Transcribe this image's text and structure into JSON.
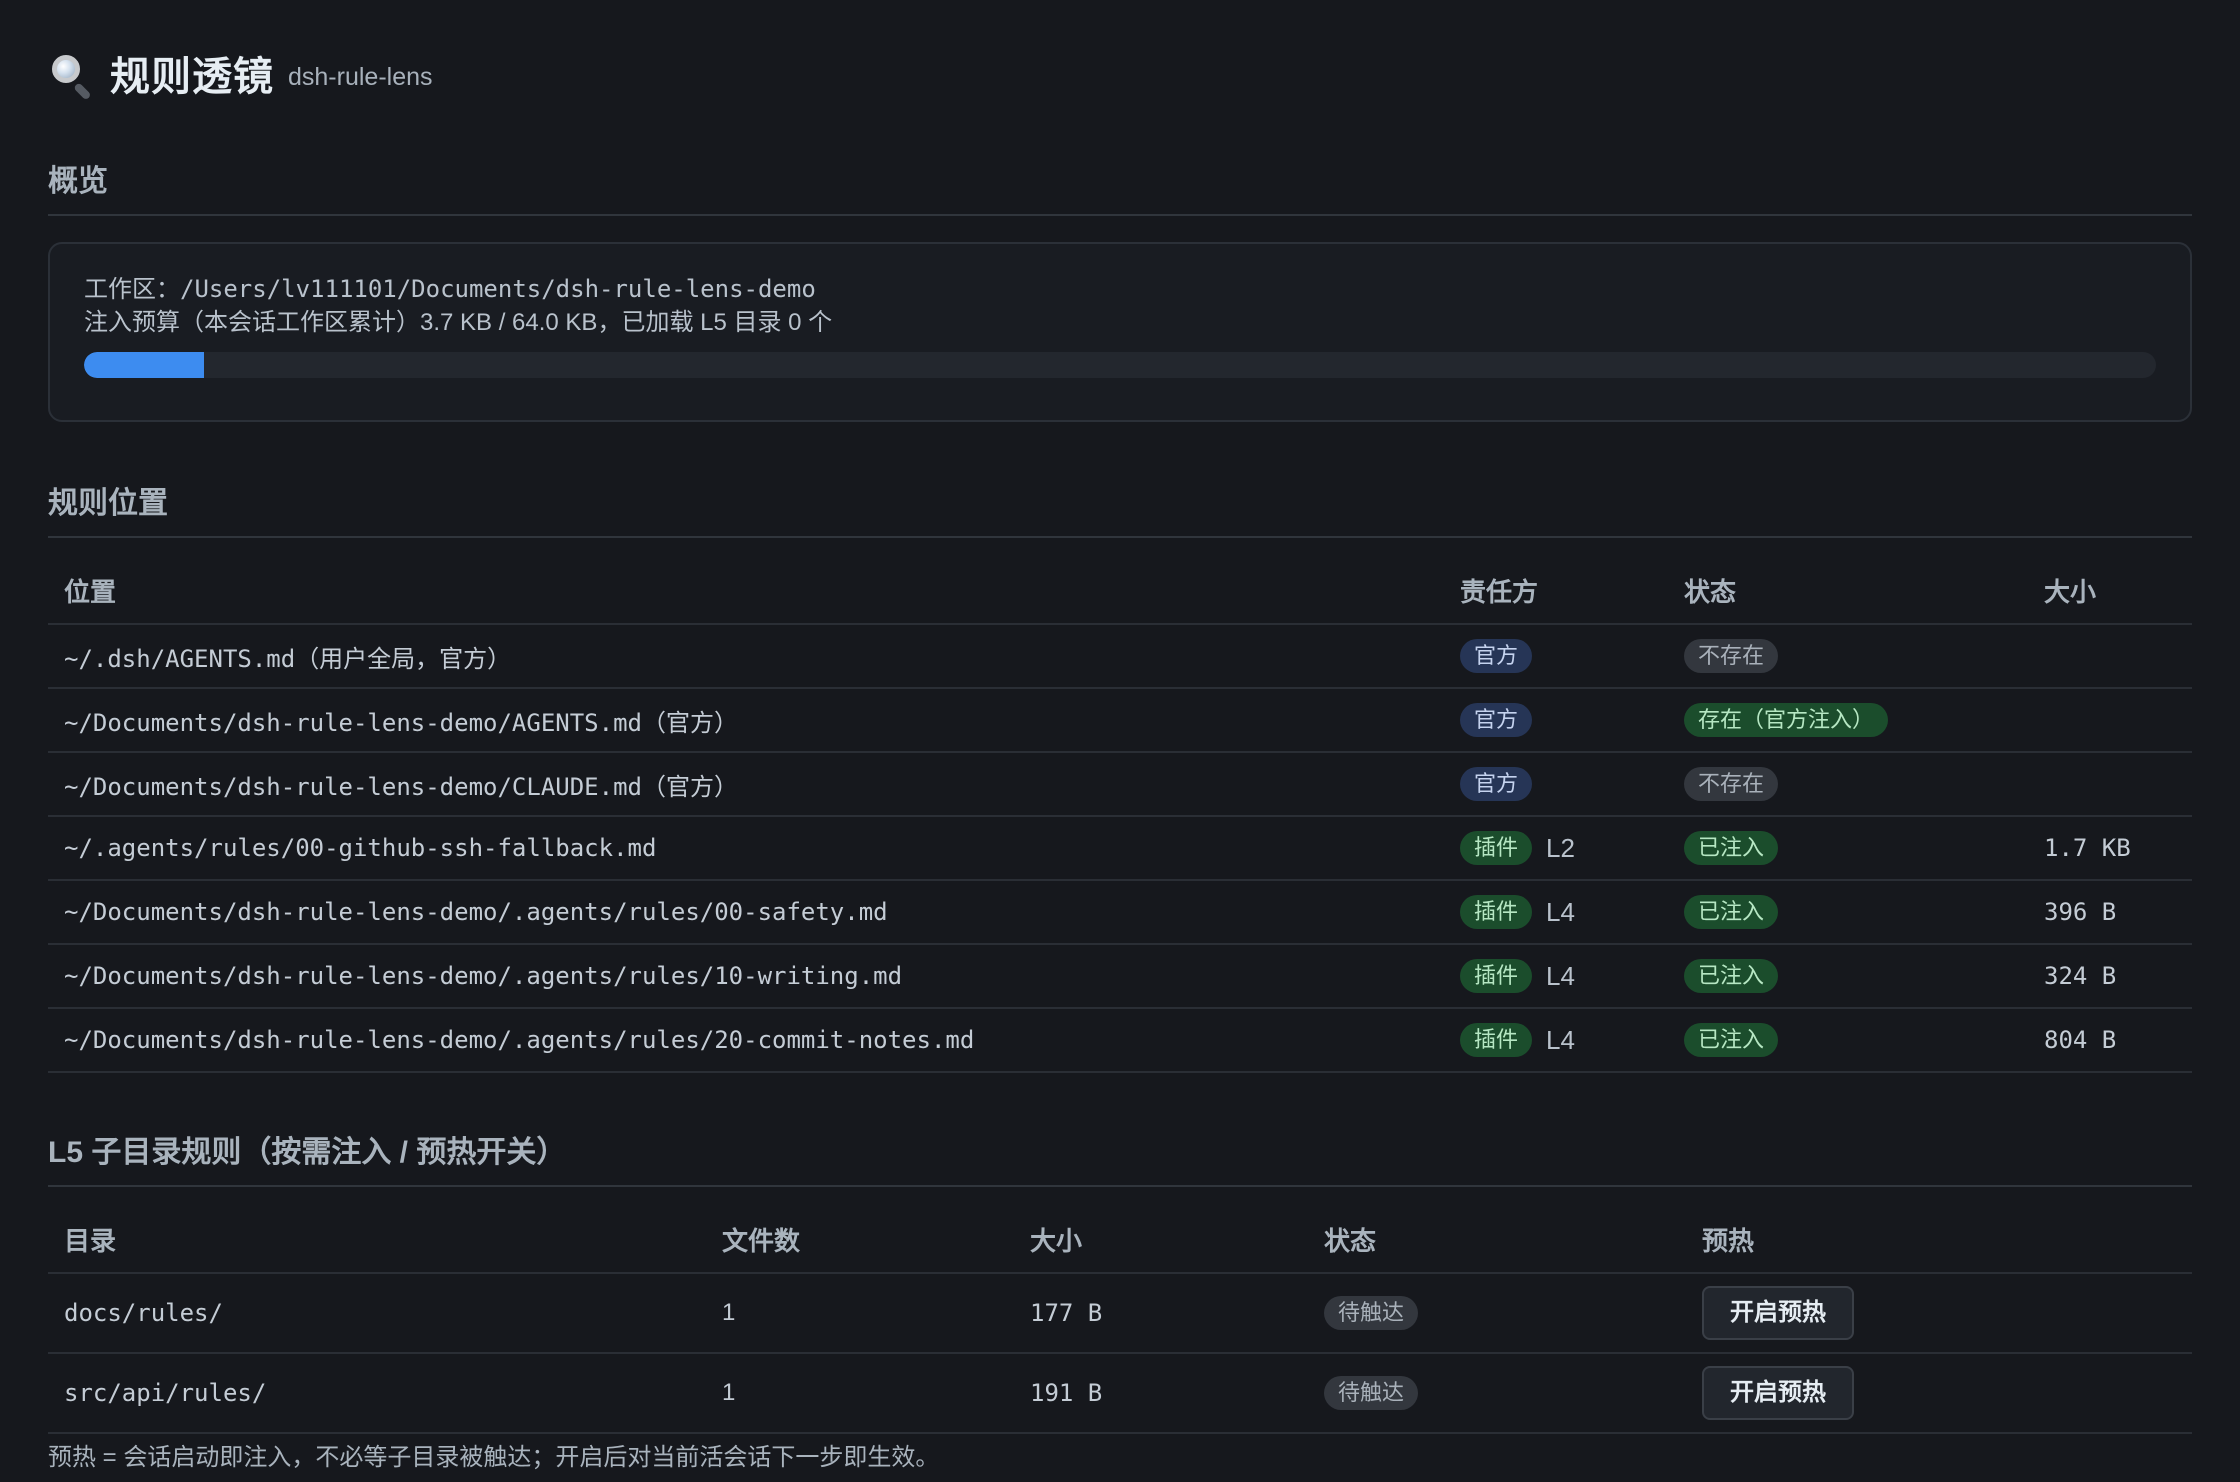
{
  "header": {
    "icon": "search-icon",
    "title": "规则透镜",
    "subtitle": "dsh-rule-lens"
  },
  "overview": {
    "title": "概览",
    "workspace_line": "工作区：/Users/lv111101/Documents/dsh-rule-lens-demo",
    "budget_line": "注入预算（本会话工作区累计）3.7 KB / 64.0 KB，已加载 L5 目录 0 个",
    "progress_fraction": 0.0578,
    "progress_color": "#3d8cf0"
  },
  "rules": {
    "title": "规则位置",
    "columns": [
      "位置",
      "责任方",
      "状态",
      "大小"
    ],
    "rows": [
      {
        "path": "~/.dsh/AGENTS.md（用户全局，官方）",
        "owner": "官方",
        "owner_kind": "official",
        "level": "",
        "status": "不存在",
        "status_kind": "absent",
        "size": ""
      },
      {
        "path": "~/Documents/dsh-rule-lens-demo/AGENTS.md（官方）",
        "owner": "官方",
        "owner_kind": "official",
        "level": "",
        "status": "存在（官方注入）",
        "status_kind": "ok",
        "size": ""
      },
      {
        "path": "~/Documents/dsh-rule-lens-demo/CLAUDE.md（官方）",
        "owner": "官方",
        "owner_kind": "official",
        "level": "",
        "status": "不存在",
        "status_kind": "absent",
        "size": ""
      },
      {
        "path": "~/.agents/rules/00-github-ssh-fallback.md",
        "owner": "插件",
        "owner_kind": "plugin",
        "level": "L2",
        "status": "已注入",
        "status_kind": "ok",
        "size": "1.7 KB"
      },
      {
        "path": "~/Documents/dsh-rule-lens-demo/.agents/rules/00-safety.md",
        "owner": "插件",
        "owner_kind": "plugin",
        "level": "L4",
        "status": "已注入",
        "status_kind": "ok",
        "size": "396 B"
      },
      {
        "path": "~/Documents/dsh-rule-lens-demo/.agents/rules/10-writing.md",
        "owner": "插件",
        "owner_kind": "plugin",
        "level": "L4",
        "status": "已注入",
        "status_kind": "ok",
        "size": "324 B"
      },
      {
        "path": "~/Documents/dsh-rule-lens-demo/.agents/rules/20-commit-notes.md",
        "owner": "插件",
        "owner_kind": "plugin",
        "level": "L4",
        "status": "已注入",
        "status_kind": "ok",
        "size": "804 B"
      }
    ]
  },
  "l5": {
    "title": "L5 子目录规则（按需注入 / 预热开关）",
    "columns": [
      "目录",
      "文件数",
      "大小",
      "状态",
      "预热"
    ],
    "rows": [
      {
        "dir": "docs/rules/",
        "count": "1",
        "size": "177 B",
        "status": "待触达",
        "action": "开启预热"
      },
      {
        "dir": "src/api/rules/",
        "count": "1",
        "size": "191 B",
        "status": "待触达",
        "action": "开启预热"
      }
    ],
    "footnote": "预热 = 会话启动即注入，不必等子目录被触达；开启后对当前活会话下一步即生效。"
  }
}
